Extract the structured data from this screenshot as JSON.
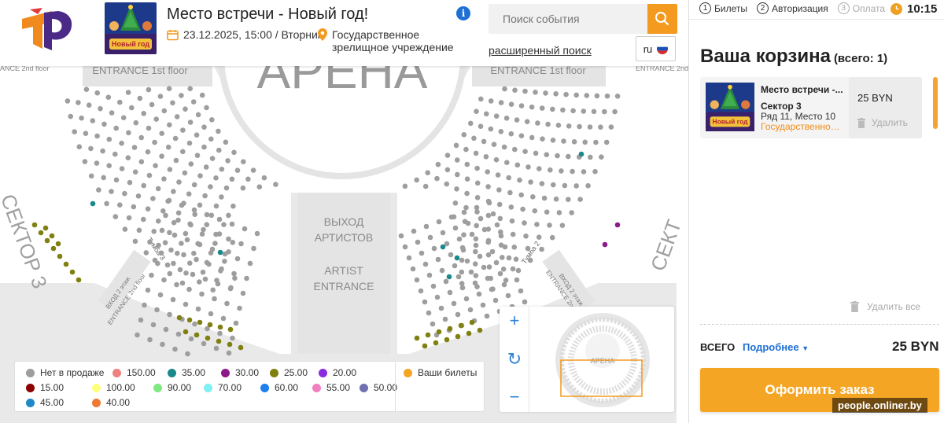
{
  "header": {
    "event_title": "Место встречи - Новый год!",
    "event_date": "23.12.2025, 15:00 / Вторник",
    "venue": "Государственное зрелищное учреждение",
    "search_placeholder": "Поиск события",
    "advanced_search": "расширенный поиск",
    "language": "ru",
    "poster_text": "Новый год"
  },
  "hall": {
    "arena_label": "АРЕНА",
    "entrance_left": "ENTRANCE 1st floor",
    "entrance_right": "ENTRANCE 1st floor",
    "entrance_2nd_left": "ANCE 2nd floor",
    "entrance_2nd_right": "ENTRANCE 2nd floor",
    "artist_exit_ru_1": "ВЫХОД",
    "artist_exit_ru_2": "АРТИСТОВ",
    "artist_exit_en_1": "ARTIST",
    "artist_exit_en_2": "ENTRANCE",
    "sector_left": "СЕКТОР 3",
    "sector_right": "СЕКТ",
    "tumba_left": "Тумба 3",
    "tumba_right": "Тумба 2",
    "entrance_2_floor_ru_left": "ВХОД 2 этаж",
    "entrance_2_floor_en_left": "ENTRANCE 2nd floor",
    "entrance_2_floor_ru_right": "ВХОД 2 этаж",
    "entrance_2_floor_en_right": "ENTRANCE 2nd floor",
    "mini_map_label": "АРЕНА"
  },
  "zoom": {
    "zoom_in": "+",
    "reset": "↻",
    "zoom_out": "−"
  },
  "legend": {
    "items": [
      {
        "label": "Нет в продаже",
        "color": "#9e9e9e"
      },
      {
        "label": "150.00",
        "color": "#f08080"
      },
      {
        "label": "35.00",
        "color": "#1b8a8a"
      },
      {
        "label": "30.00",
        "color": "#8b1a8b"
      },
      {
        "label": "25.00",
        "color": "#808010"
      },
      {
        "label": "20.00",
        "color": "#8a2be2"
      },
      {
        "label": "15.00",
        "color": "#8b0000"
      },
      {
        "label": "100.00",
        "color": "#ffff80"
      },
      {
        "label": "90.00",
        "color": "#80e880"
      },
      {
        "label": "70.00",
        "color": "#80f0f0"
      },
      {
        "label": "60.00",
        "color": "#1e7ff0"
      },
      {
        "label": "55.00",
        "color": "#f080c0"
      },
      {
        "label": "50.00",
        "color": "#7070b0"
      },
      {
        "label": "45.00",
        "color": "#1e88c8"
      },
      {
        "label": "40.00",
        "color": "#f07830"
      }
    ],
    "your_tickets": {
      "label": "Ваши билеты",
      "color": "#f5a524"
    }
  },
  "panel": {
    "steps": [
      {
        "num": "1",
        "label": "Билеты"
      },
      {
        "num": "2",
        "label": "Авторизация"
      },
      {
        "num": "3",
        "label": "Оплата"
      }
    ],
    "timer": "10:15",
    "cart_title": "Ваша корзина",
    "cart_count": "(всего: 1)",
    "ticket": {
      "name": "Место встречи -...",
      "sector": "Сектор 3",
      "row_seat": "Ряд 11, Место 10",
      "venue": "Государственное...",
      "price": "25 BYN",
      "delete": "Удалить"
    },
    "delete_all": "Удалить все",
    "total_label": "ВСЕГО",
    "details": "Подробнее",
    "total_sum": "25 BYN",
    "order_button": "Оформить заказ"
  },
  "watermark": "people.onliner.by",
  "colors": {
    "accent": "#f5a524",
    "link": "#1f6fd4",
    "seat_na": "#9e9e9e"
  }
}
